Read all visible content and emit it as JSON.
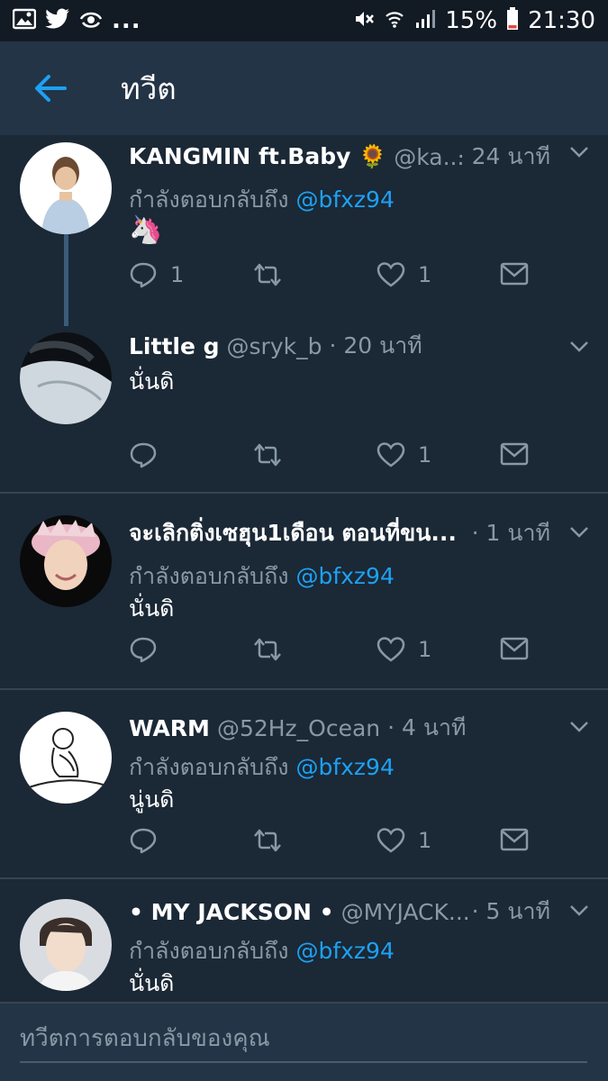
{
  "status_bar": {
    "battery": "15%",
    "time": "21:30",
    "more": "..."
  },
  "app_bar": {
    "title": "ทวีต"
  },
  "tweets": [
    {
      "name": "KANGMIN ft.Baby 🌻",
      "handle": "@ka...",
      "time": "· 24 นาที",
      "reply_prefix": "กำลังตอบกลับถึง",
      "reply_to": "@bfxz94",
      "body": "🦄",
      "replies": "1",
      "retweets": "",
      "likes": "1"
    },
    {
      "name": "Little g",
      "handle": "@sryk_b",
      "time": "· 20 นาที",
      "reply_prefix": "",
      "reply_to": "",
      "body": "นั่นดิ",
      "replies": "",
      "retweets": "",
      "likes": "1"
    },
    {
      "name": "จะเลิกติ่งเซฮุน1เดือน ตอนที่ขน...",
      "handle": "",
      "time": "· 1 นาที",
      "reply_prefix": "กำลังตอบกลับถึง",
      "reply_to": "@bfxz94",
      "body": "นั่นดิ",
      "replies": "",
      "retweets": "",
      "likes": "1"
    },
    {
      "name": "WARM",
      "handle": "@52Hz_Ocean",
      "time": "· 4 นาที",
      "reply_prefix": "กำลังตอบกลับถึง",
      "reply_to": "@bfxz94",
      "body": "นู่นดิ",
      "replies": "",
      "retweets": "",
      "likes": "1"
    },
    {
      "name": "• MY JACKSON •",
      "handle": "@MYJACK...",
      "time": "· 5 นาที",
      "reply_prefix": "กำลังตอบกลับถึง",
      "reply_to": "@bfxz94",
      "body": "นั่นดิ",
      "replies": "",
      "retweets": "",
      "likes": ""
    }
  ],
  "composer": {
    "placeholder": "ทวีตการตอบกลับของคุณ"
  },
  "colors": {
    "background": "#1b2836",
    "header": "#243447",
    "accent": "#1da1f2",
    "muted": "#8899a6",
    "divider": "#38444d"
  }
}
